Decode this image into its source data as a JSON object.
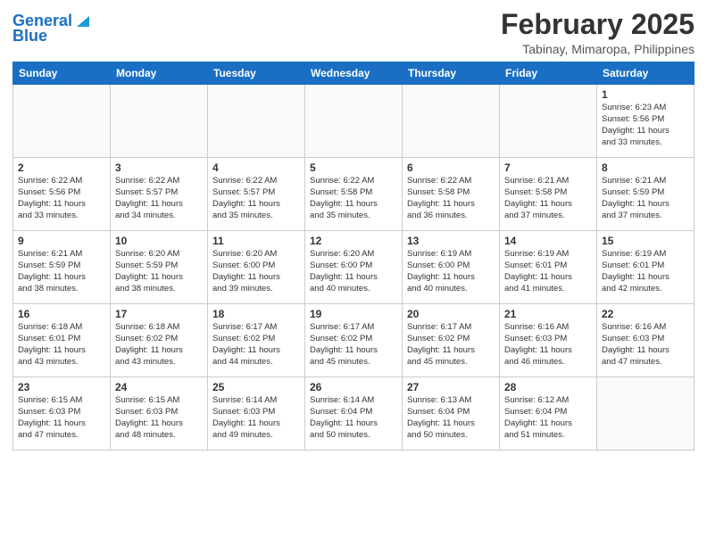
{
  "header": {
    "logo_line1": "General",
    "logo_line2": "Blue",
    "month": "February 2025",
    "location": "Tabinay, Mimaropa, Philippines"
  },
  "weekdays": [
    "Sunday",
    "Monday",
    "Tuesday",
    "Wednesday",
    "Thursday",
    "Friday",
    "Saturday"
  ],
  "weeks": [
    [
      {
        "day": "",
        "info": ""
      },
      {
        "day": "",
        "info": ""
      },
      {
        "day": "",
        "info": ""
      },
      {
        "day": "",
        "info": ""
      },
      {
        "day": "",
        "info": ""
      },
      {
        "day": "",
        "info": ""
      },
      {
        "day": "1",
        "info": "Sunrise: 6:23 AM\nSunset: 5:56 PM\nDaylight: 11 hours\nand 33 minutes."
      }
    ],
    [
      {
        "day": "2",
        "info": "Sunrise: 6:22 AM\nSunset: 5:56 PM\nDaylight: 11 hours\nand 33 minutes."
      },
      {
        "day": "3",
        "info": "Sunrise: 6:22 AM\nSunset: 5:57 PM\nDaylight: 11 hours\nand 34 minutes."
      },
      {
        "day": "4",
        "info": "Sunrise: 6:22 AM\nSunset: 5:57 PM\nDaylight: 11 hours\nand 35 minutes."
      },
      {
        "day": "5",
        "info": "Sunrise: 6:22 AM\nSunset: 5:58 PM\nDaylight: 11 hours\nand 35 minutes."
      },
      {
        "day": "6",
        "info": "Sunrise: 6:22 AM\nSunset: 5:58 PM\nDaylight: 11 hours\nand 36 minutes."
      },
      {
        "day": "7",
        "info": "Sunrise: 6:21 AM\nSunset: 5:58 PM\nDaylight: 11 hours\nand 37 minutes."
      },
      {
        "day": "8",
        "info": "Sunrise: 6:21 AM\nSunset: 5:59 PM\nDaylight: 11 hours\nand 37 minutes."
      }
    ],
    [
      {
        "day": "9",
        "info": "Sunrise: 6:21 AM\nSunset: 5:59 PM\nDaylight: 11 hours\nand 38 minutes."
      },
      {
        "day": "10",
        "info": "Sunrise: 6:20 AM\nSunset: 5:59 PM\nDaylight: 11 hours\nand 38 minutes."
      },
      {
        "day": "11",
        "info": "Sunrise: 6:20 AM\nSunset: 6:00 PM\nDaylight: 11 hours\nand 39 minutes."
      },
      {
        "day": "12",
        "info": "Sunrise: 6:20 AM\nSunset: 6:00 PM\nDaylight: 11 hours\nand 40 minutes."
      },
      {
        "day": "13",
        "info": "Sunrise: 6:19 AM\nSunset: 6:00 PM\nDaylight: 11 hours\nand 40 minutes."
      },
      {
        "day": "14",
        "info": "Sunrise: 6:19 AM\nSunset: 6:01 PM\nDaylight: 11 hours\nand 41 minutes."
      },
      {
        "day": "15",
        "info": "Sunrise: 6:19 AM\nSunset: 6:01 PM\nDaylight: 11 hours\nand 42 minutes."
      }
    ],
    [
      {
        "day": "16",
        "info": "Sunrise: 6:18 AM\nSunset: 6:01 PM\nDaylight: 11 hours\nand 43 minutes."
      },
      {
        "day": "17",
        "info": "Sunrise: 6:18 AM\nSunset: 6:02 PM\nDaylight: 11 hours\nand 43 minutes."
      },
      {
        "day": "18",
        "info": "Sunrise: 6:17 AM\nSunset: 6:02 PM\nDaylight: 11 hours\nand 44 minutes."
      },
      {
        "day": "19",
        "info": "Sunrise: 6:17 AM\nSunset: 6:02 PM\nDaylight: 11 hours\nand 45 minutes."
      },
      {
        "day": "20",
        "info": "Sunrise: 6:17 AM\nSunset: 6:02 PM\nDaylight: 11 hours\nand 45 minutes."
      },
      {
        "day": "21",
        "info": "Sunrise: 6:16 AM\nSunset: 6:03 PM\nDaylight: 11 hours\nand 46 minutes."
      },
      {
        "day": "22",
        "info": "Sunrise: 6:16 AM\nSunset: 6:03 PM\nDaylight: 11 hours\nand 47 minutes."
      }
    ],
    [
      {
        "day": "23",
        "info": "Sunrise: 6:15 AM\nSunset: 6:03 PM\nDaylight: 11 hours\nand 47 minutes."
      },
      {
        "day": "24",
        "info": "Sunrise: 6:15 AM\nSunset: 6:03 PM\nDaylight: 11 hours\nand 48 minutes."
      },
      {
        "day": "25",
        "info": "Sunrise: 6:14 AM\nSunset: 6:03 PM\nDaylight: 11 hours\nand 49 minutes."
      },
      {
        "day": "26",
        "info": "Sunrise: 6:14 AM\nSunset: 6:04 PM\nDaylight: 11 hours\nand 50 minutes."
      },
      {
        "day": "27",
        "info": "Sunrise: 6:13 AM\nSunset: 6:04 PM\nDaylight: 11 hours\nand 50 minutes."
      },
      {
        "day": "28",
        "info": "Sunrise: 6:12 AM\nSunset: 6:04 PM\nDaylight: 11 hours\nand 51 minutes."
      },
      {
        "day": "",
        "info": ""
      }
    ]
  ]
}
